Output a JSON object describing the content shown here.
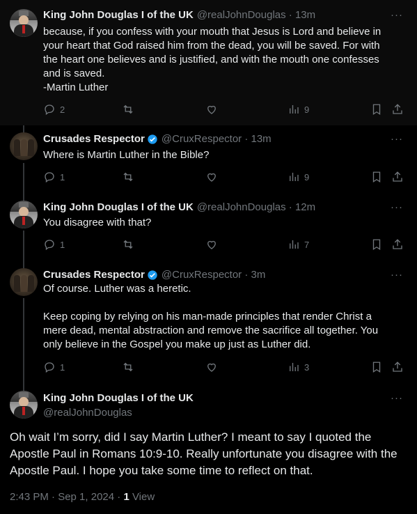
{
  "tweets": [
    {
      "name": "King John Douglas I of the UK",
      "handle": "@realJohnDouglas · 13m",
      "text": "because, if you confess with your mouth that Jesus is Lord and believe in your heart that God raised him from the dead, you will be saved. For with the heart one believes and is justified, and with the mouth one confesses and is saved.\n-Martin Luther",
      "replies": "2",
      "retweets": "",
      "likes": "",
      "views": "9"
    },
    {
      "name": "Crusades Respector",
      "handle": "@CruxRespector · 13m",
      "text": "Where is Martin Luther in the Bible?",
      "replies": "1",
      "retweets": "",
      "likes": "",
      "views": "9"
    },
    {
      "name": "King John Douglas I of the UK",
      "handle": "@realJohnDouglas · 12m",
      "text": "You disagree with that?",
      "replies": "1",
      "retweets": "",
      "likes": "",
      "views": "7"
    },
    {
      "name": "Crusades Respector",
      "handle": "@CruxRespector · 3m",
      "text": "Of course. Luther was a heretic.\n\nKeep coping by relying on his man-made principles that render Christ a mere dead, mental abstraction and remove the sacrifice all together. You only believe in the Gospel you make up just as Luther did.",
      "replies": "1",
      "retweets": "",
      "likes": "",
      "views": "3"
    }
  ],
  "main_tweet": {
    "name": "King John Douglas I of the UK",
    "handle": "@realJohnDouglas",
    "text": "Oh wait I’m sorry, did I say Martin Luther? I meant to say I quoted the Apostle Paul in Romans 10:9-10. Really unfortunate you disagree with the Apostle Paul. I hope you take some time to reflect on that.",
    "timestamp": "2:43 PM · Sep 1, 2024 · ",
    "view_count": "1",
    "view_label": " View"
  },
  "more_glyph": "···",
  "icons": {
    "reply": "reply-icon",
    "retweet": "retweet-icon",
    "like": "heart-icon",
    "views": "views-icon",
    "bookmark": "bookmark-icon",
    "share": "share-icon",
    "verified": "verified-icon"
  },
  "colors": {
    "background": "#000000",
    "text": "#e7e9ea",
    "muted": "#71767b",
    "verified": "#1d9bf0"
  }
}
